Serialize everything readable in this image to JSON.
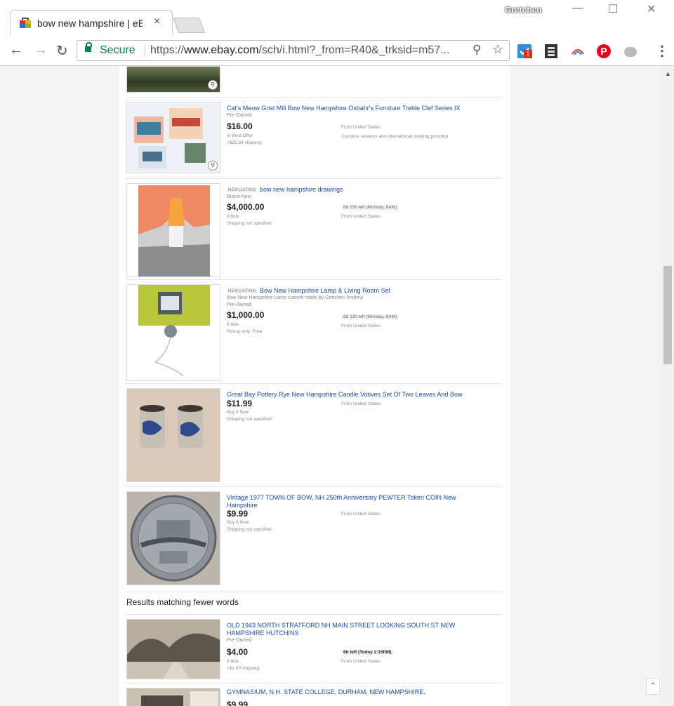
{
  "browser": {
    "tab_title": "bow new hampshire | eB",
    "tab_close": "×",
    "profile_name": "Gretchen",
    "minimize": "—",
    "maximize": "☐",
    "close": "✕",
    "secure_label": "Secure",
    "url_scheme": "https://",
    "url_host": "www.ebay.com",
    "url_path": "/sch/i.html?_from=R40&_trksid=m57...",
    "extension_badge": "1",
    "icons": [
      "back-icon",
      "forward-icon",
      "reload-icon",
      "lock-icon",
      "zoom-icon",
      "star-icon",
      "task-extension-icon",
      "film-extension-icon",
      "arc-extension-icon",
      "pinterest-icon",
      "cloud-extension-icon",
      "menu-icon"
    ]
  },
  "listings": [
    {
      "title": "Cat's Meow Grist Mill Bow New Hampshire Osbahr's Furniture Treble Clef Series IX",
      "new_listing": "",
      "condition": "Pre-Owned",
      "extra": "",
      "price": "$16.00",
      "lines": [
        "or Best Offer",
        "+$25.54 shipping"
      ],
      "right": [
        "From United States",
        "Customs services and international tracking provided"
      ]
    },
    {
      "title": "bow new hampshire  drawings",
      "new_listing": "NEW LISTING",
      "condition": "Brand New",
      "extra": "",
      "price": "$4,000.00",
      "lines": [
        "0 bids",
        "Shipping not specified"
      ],
      "right": [
        "6d 23h left (Monday, 8AM)",
        "From United States"
      ]
    },
    {
      "title": "Bow New Hampshire Lamp & Living Room Set",
      "new_listing": "NEW LISTING",
      "condition": "Pre-Owned",
      "extra": "Bow New Hampshire Lamp custom made by Gretchen Andrew",
      "price": "$1,000.00",
      "lines": [
        "0 bids",
        "Pickup only: Free"
      ],
      "right": [
        "6d 23h left (Monday, 8AM)",
        "From United States"
      ]
    },
    {
      "title": "Great Bay Pottery Rye New Hampshire Candle Votives Set Of Two Leaves And Bow",
      "new_listing": "",
      "condition": "",
      "extra": "",
      "price": "$11.99",
      "lines": [
        "Buy It Now",
        "Shipping not specified"
      ],
      "right": [
        "From United States"
      ]
    },
    {
      "title": "Vintage 1977 TOWN OF BOW, NH 250th Anniversary PEWTER Token COIN New Hampshire",
      "new_listing": "",
      "condition": "",
      "extra": "",
      "price": "$9.99",
      "lines": [
        "Buy It Now",
        "Shipping not specified"
      ],
      "right": [
        "From United States"
      ]
    }
  ],
  "fewer_words_heading": "Results matching fewer words",
  "fewer_listings": [
    {
      "title": "OLD 1943 NORTH STRATFORD NH MAIN STREET LOOKING SOUTH ST NEW HAMPSHIRE HUTCHINS",
      "condition": "Pre-Owned",
      "price": "$4.00",
      "lines": [
        "0 bids",
        "+$1.00 shipping"
      ],
      "right": [
        "6h left (Today 2:15PM)",
        "From United States"
      ]
    },
    {
      "title": "GYMNASIUM, N.H. STATE COLLEGE, DURHAM, NEW HAMPSHIRE.",
      "condition": "",
      "price": "$9.99",
      "lines": [],
      "right": []
    }
  ],
  "scroll_up_glyph": "▲",
  "back_to_top_glyph": "⌃"
}
